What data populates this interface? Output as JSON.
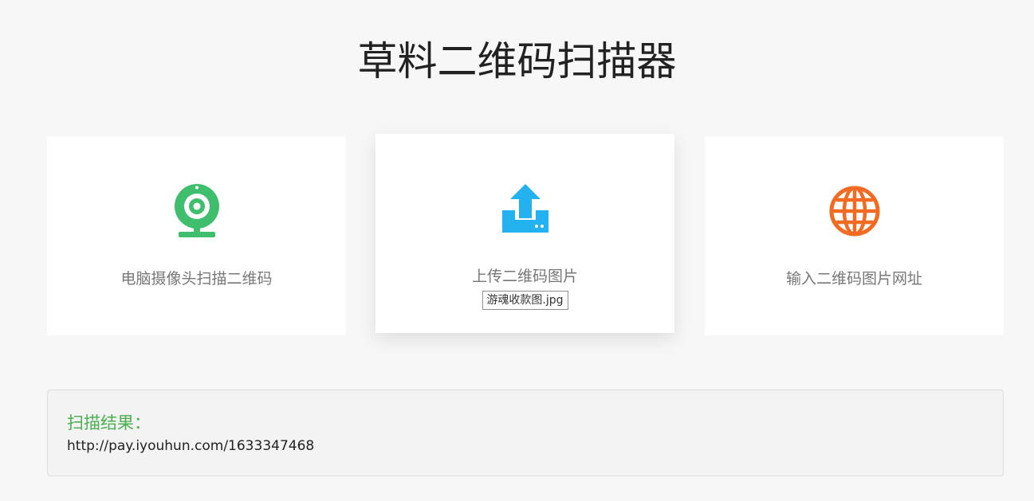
{
  "header": {
    "title": "草料二维码扫描器"
  },
  "options": [
    {
      "id": "camera",
      "label": "电脑摄像头扫描二维码",
      "icon": "webcam-icon",
      "color": "#3fbf6d"
    },
    {
      "id": "upload",
      "label": "上传二维码图片",
      "icon": "upload-icon",
      "color": "#23b2ef",
      "selected_file": "游魂收款图.jpg"
    },
    {
      "id": "url",
      "label": "输入二维码图片网址",
      "icon": "globe-icon",
      "color": "#f26b22"
    }
  ],
  "result": {
    "title": "扫描结果：",
    "value": "http://pay.iyouhun.com/1633347468",
    "title_color": "#4caf50"
  },
  "colors": {
    "background": "#f7f7f7",
    "card_background": "#ffffff",
    "result_background": "#f3f3f3"
  }
}
